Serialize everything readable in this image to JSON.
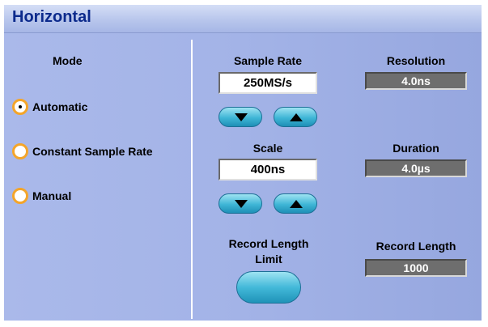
{
  "window": {
    "title": "Horizontal"
  },
  "mode": {
    "label": "Mode",
    "options": [
      {
        "label": "Automatic",
        "selected": true
      },
      {
        "label": "Constant Sample Rate",
        "selected": false
      },
      {
        "label": "Manual",
        "selected": false
      }
    ]
  },
  "sample_rate": {
    "label": "Sample Rate",
    "value": "250MS/s"
  },
  "scale": {
    "label": "Scale",
    "value": "400ns"
  },
  "record_length_limit": {
    "label_line1": "Record Length",
    "label_line2": "Limit"
  },
  "resolution": {
    "label": "Resolution",
    "value": "4.0ns"
  },
  "duration": {
    "label": "Duration",
    "value": "4.0µs"
  },
  "record_length": {
    "label": "Record Length",
    "value": "1000"
  },
  "colors": {
    "title_text": "#0c2a8c",
    "panel": "#a3b3e7",
    "radio_ring": "#f4a52a",
    "button": "#3fb6d6",
    "readout": "#6e6e6e"
  }
}
